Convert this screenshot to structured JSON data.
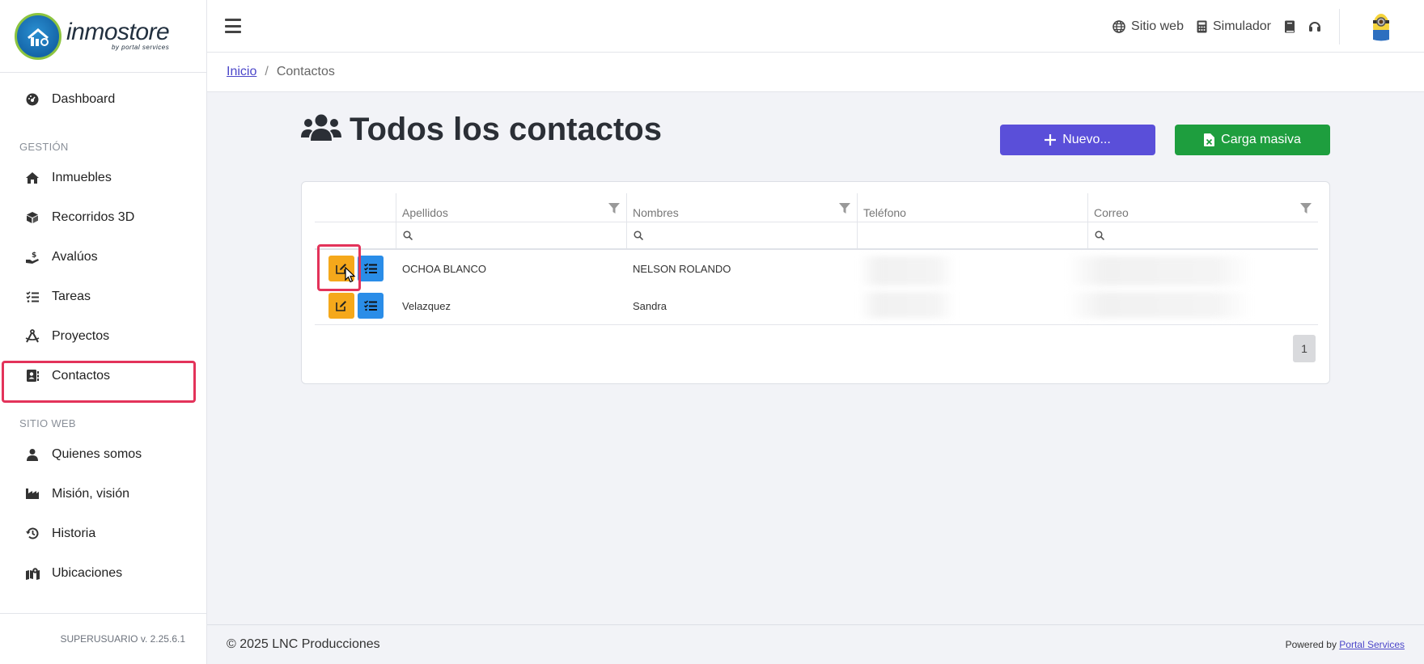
{
  "brand": {
    "name": "inmostore",
    "sub": "by portal services"
  },
  "sidebar": {
    "dashboard": "Dashboard",
    "section_gestion": "GESTIÓN",
    "gestion_items": [
      {
        "label": "Inmuebles",
        "icon": "home-icon"
      },
      {
        "label": "Recorridos 3D",
        "icon": "cube-icon"
      },
      {
        "label": "Avalúos",
        "icon": "hand-dollar-icon"
      },
      {
        "label": "Tareas",
        "icon": "tasks-icon"
      },
      {
        "label": "Proyectos",
        "icon": "compass-drafting-icon"
      },
      {
        "label": "Contactos",
        "icon": "address-book-icon"
      }
    ],
    "section_sitio": "SITIO WEB",
    "sitio_items": [
      {
        "label": "Quienes somos",
        "icon": "user-icon"
      },
      {
        "label": "Misión, visión",
        "icon": "industry-icon"
      },
      {
        "label": "Historia",
        "icon": "history-icon"
      },
      {
        "label": "Ubicaciones",
        "icon": "map-location-icon"
      }
    ],
    "footer": "SUPERUSUARIO v. 2.25.6.1"
  },
  "topbar": {
    "sitio_web": "Sitio web",
    "simulador": "Simulador"
  },
  "breadcrumb": {
    "home": "Inicio",
    "separator": "/",
    "current": "Contactos"
  },
  "page": {
    "title": "Todos los contactos",
    "new_button": "Nuevo...",
    "bulk_button": "Carga masiva"
  },
  "table": {
    "columns": [
      "Apellidos",
      "Nombres",
      "Teléfono",
      "Correo"
    ],
    "rows": [
      {
        "apellidos": "OCHOA BLANCO",
        "nombres": "NELSON ROLANDO"
      },
      {
        "apellidos": "Velazquez",
        "nombres": "Sandra"
      }
    ],
    "page": "1"
  },
  "footer": {
    "copyright": "© 2025 LNC Producciones",
    "powered_prefix": "Powered by",
    "powered_link": "Portal Services"
  },
  "colors": {
    "primary": "#5a4fd9",
    "success": "#1e9e3e",
    "edit": "#f5a81b",
    "info": "#2a8de8",
    "highlight": "#e3335a"
  }
}
